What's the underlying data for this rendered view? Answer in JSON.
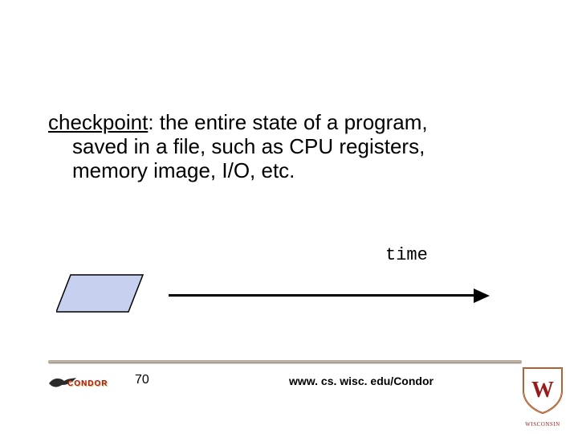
{
  "body": {
    "term": "checkpoint",
    "line1_after_term": ": the entire state of a program,",
    "line2": "saved in a file, such as CPU registers,",
    "line3": "memory image, I/O, etc."
  },
  "diagram": {
    "time_label": "time"
  },
  "footer": {
    "page": "70",
    "url": "www. cs. wisc. edu/Condor",
    "condor_brand": "CONDOR",
    "university": "WISCONSIN"
  }
}
